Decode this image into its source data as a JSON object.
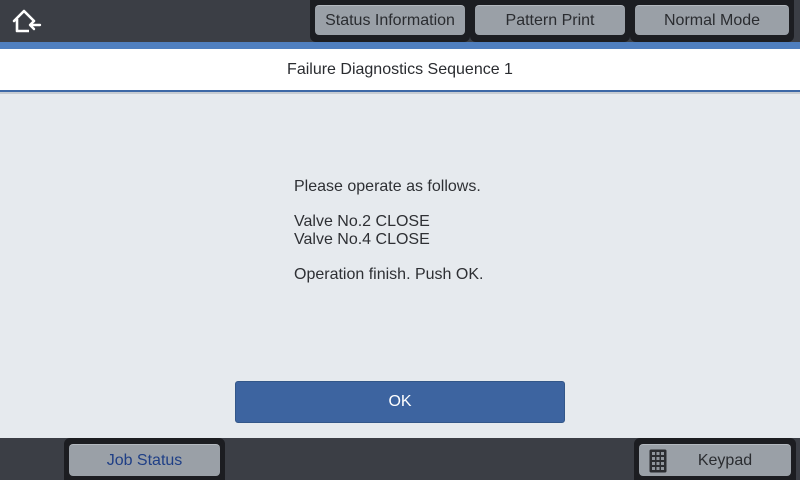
{
  "header": {
    "tabs": [
      {
        "label": "Status Information"
      },
      {
        "label": "Pattern Print"
      },
      {
        "label": "Normal Mode"
      }
    ],
    "home_icon": "home-back-icon"
  },
  "title": "Failure Diagnostics Sequence 1",
  "message": {
    "line1": "Please operate as follows.",
    "line2": "Valve No.2 CLOSE",
    "line3": "Valve No.4 CLOSE",
    "line4": "Operation finish. Push OK."
  },
  "ok_label": "OK",
  "footer": {
    "job_status_label": "Job Status",
    "keypad_label": "Keypad",
    "keypad_icon": "keypad-icon"
  },
  "colors": {
    "accent": "#4f7fbf",
    "ok_button": "#3d64a0",
    "bar": "#3b3e45"
  }
}
